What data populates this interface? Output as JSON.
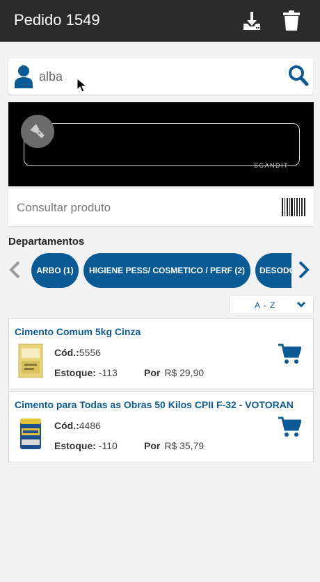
{
  "header": {
    "title": "Pedido 1549",
    "download_icon": "download-icon",
    "delete_icon": "trash-icon"
  },
  "search": {
    "value": "alba",
    "placeholder": ""
  },
  "scanner": {
    "brand": "SCANDIT",
    "flash_icon": "flashlight-icon"
  },
  "product_search": {
    "placeholder": "Consultar produto",
    "barcode_icon": "barcode-icon"
  },
  "departments": {
    "title": "Departamentos",
    "chips": [
      {
        "label": "ARBO (1)"
      },
      {
        "label": "HIGIENE PESS/ COSMETICO / PERF (2)"
      },
      {
        "label": "DESODO"
      }
    ]
  },
  "sort": {
    "label": "A - Z"
  },
  "products": [
    {
      "name": "Cimento Comum 5kg Cinza",
      "code_label": "Cód.:",
      "code": "5556",
      "stock_label": "Estoque:",
      "stock": "-113",
      "price_label": "Por",
      "price": "R$ 29,90"
    },
    {
      "name": "Cimento para Todas as Obras 50 Kilos CPII F-32 - VOTORAN",
      "code_label": "Cód.:",
      "code": "4486",
      "stock_label": "Estoque:",
      "stock": "-110",
      "price_label": "Por",
      "price": "R$ 35,79"
    }
  ],
  "colors": {
    "header_bg": "#2b2b2b",
    "primary": "#0a5a96",
    "background": "#f2f2f2"
  }
}
